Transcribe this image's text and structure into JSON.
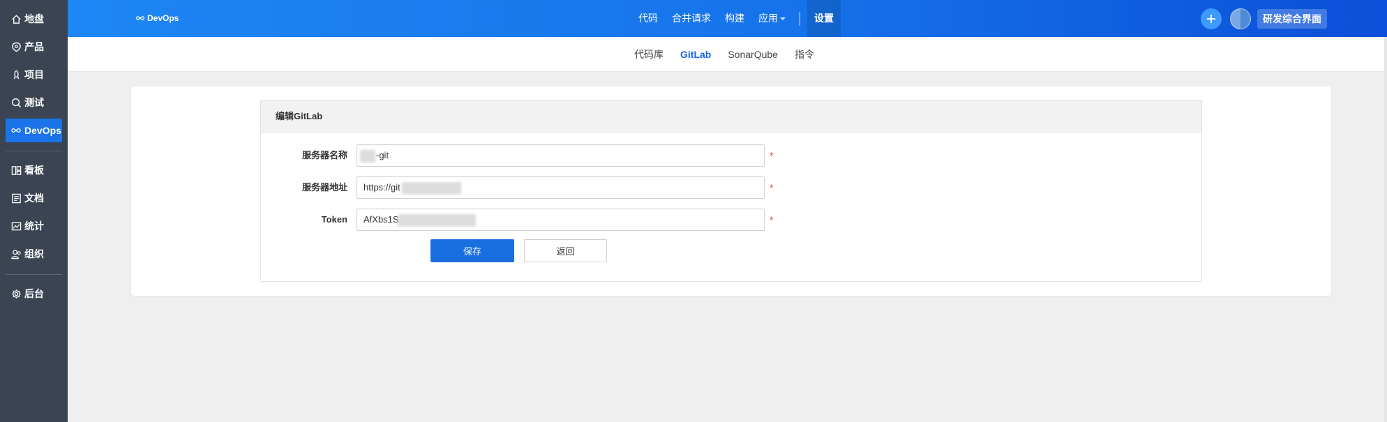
{
  "sidebar": {
    "items": [
      {
        "label": "地盘",
        "icon": "home-icon"
      },
      {
        "label": "产品",
        "icon": "product-icon"
      },
      {
        "label": "项目",
        "icon": "project-icon"
      },
      {
        "label": "测试",
        "icon": "test-icon"
      },
      {
        "label": "DevOps",
        "icon": "devops-icon",
        "active": true
      },
      {
        "label": "看板",
        "icon": "kanban-icon"
      },
      {
        "label": "文档",
        "icon": "doc-icon"
      },
      {
        "label": "统计",
        "icon": "chart-icon"
      },
      {
        "label": "组织",
        "icon": "org-icon"
      },
      {
        "label": "后台",
        "icon": "gear-icon"
      }
    ]
  },
  "header": {
    "logo_text": "DevOps",
    "nav": [
      "代码",
      "合并请求",
      "构建",
      "应用",
      "设置"
    ],
    "active_nav": "设置",
    "workspace_label": "研发综合界面"
  },
  "subnav": {
    "items": [
      "代码库",
      "GitLab",
      "SonarQube",
      "指令"
    ],
    "active": "GitLab"
  },
  "form": {
    "title": "编辑GitLab",
    "fields": [
      {
        "label": "服务器名称",
        "value": "-git",
        "required_mark": "*"
      },
      {
        "label": "服务器地址",
        "value": "https://git",
        "required_mark": "*"
      },
      {
        "label": "Token",
        "value": "AfXbs1S",
        "required_mark": "*"
      }
    ],
    "save_label": "保存",
    "back_label": "返回"
  },
  "colors": {
    "sidebar_bg": "#3a4453",
    "accent": "#1a73e8",
    "header_gradient_start": "#1e86f5",
    "header_gradient_end": "#0c4fd8",
    "required": "#e53935"
  }
}
